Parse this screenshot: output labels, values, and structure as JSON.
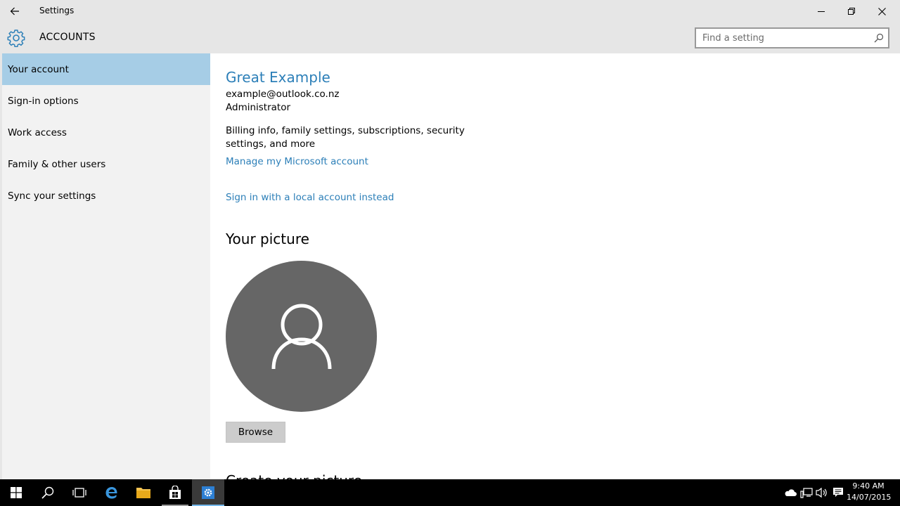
{
  "window": {
    "title": "Settings",
    "section": "ACCOUNTS",
    "search_placeholder": "Find a setting"
  },
  "sidebar": {
    "items": [
      {
        "label": "Your account",
        "selected": true
      },
      {
        "label": "Sign-in options"
      },
      {
        "label": "Work access"
      },
      {
        "label": "Family & other users"
      },
      {
        "label": "Sync your settings"
      }
    ]
  },
  "account": {
    "name": "Great Example",
    "email": "example@outlook.co.nz",
    "role": "Administrator",
    "billing_text": "Billing info, family settings, subscriptions, security settings, and more",
    "manage_link": "Manage my Microsoft account",
    "local_link": "Sign in with a local account instead"
  },
  "picture": {
    "heading": "Your picture",
    "browse_label": "Browse",
    "next_heading_partial": "Create your picture"
  },
  "taskbar": {
    "time": "9:40 AM",
    "date": "14/07/2015"
  },
  "colors": {
    "accent": "#2c7fb8",
    "selected_nav": "#a6cde6",
    "avatar_bg": "#666666"
  }
}
